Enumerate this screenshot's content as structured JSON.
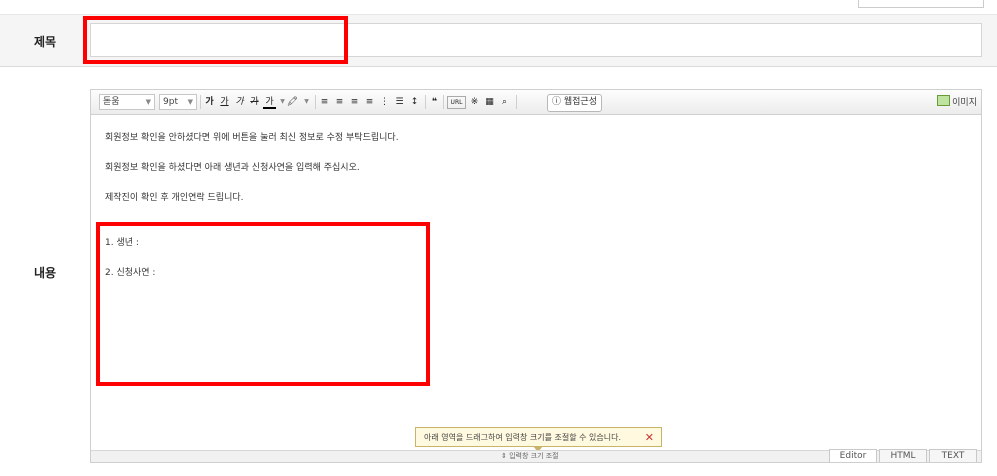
{
  "title_row": {
    "label": "제목",
    "input_value": ""
  },
  "content_label": "내용",
  "toolbar": {
    "font_family": "돋움",
    "font_size": "9pt",
    "bold": "가",
    "underline": "가",
    "italic": "가",
    "strike": "가",
    "font_color": "가",
    "quote": "❝",
    "url": "URL",
    "accessibility": "웹접근성",
    "image": "이미지"
  },
  "content": {
    "lines": [
      "회원정보 확인을 안하셨다면 위에 버튼을 눌러 최신 정보로 수정 부탁드립니다.",
      "회원정보 확인을 하셨다면 아래 생년과 신청사연을 입력해 주십시오.",
      "제작진이 확인 후 개인연락 드립니다.",
      "1. 생년 :",
      "2. 신청사연 :"
    ]
  },
  "tooltip": {
    "text": "아래 영역을 드래그하여 입력창 크기를 조절할 수 있습니다."
  },
  "resize_label": "⇕ 입력창 크기 조절",
  "modes": [
    "Editor",
    "HTML",
    "TEXT"
  ]
}
